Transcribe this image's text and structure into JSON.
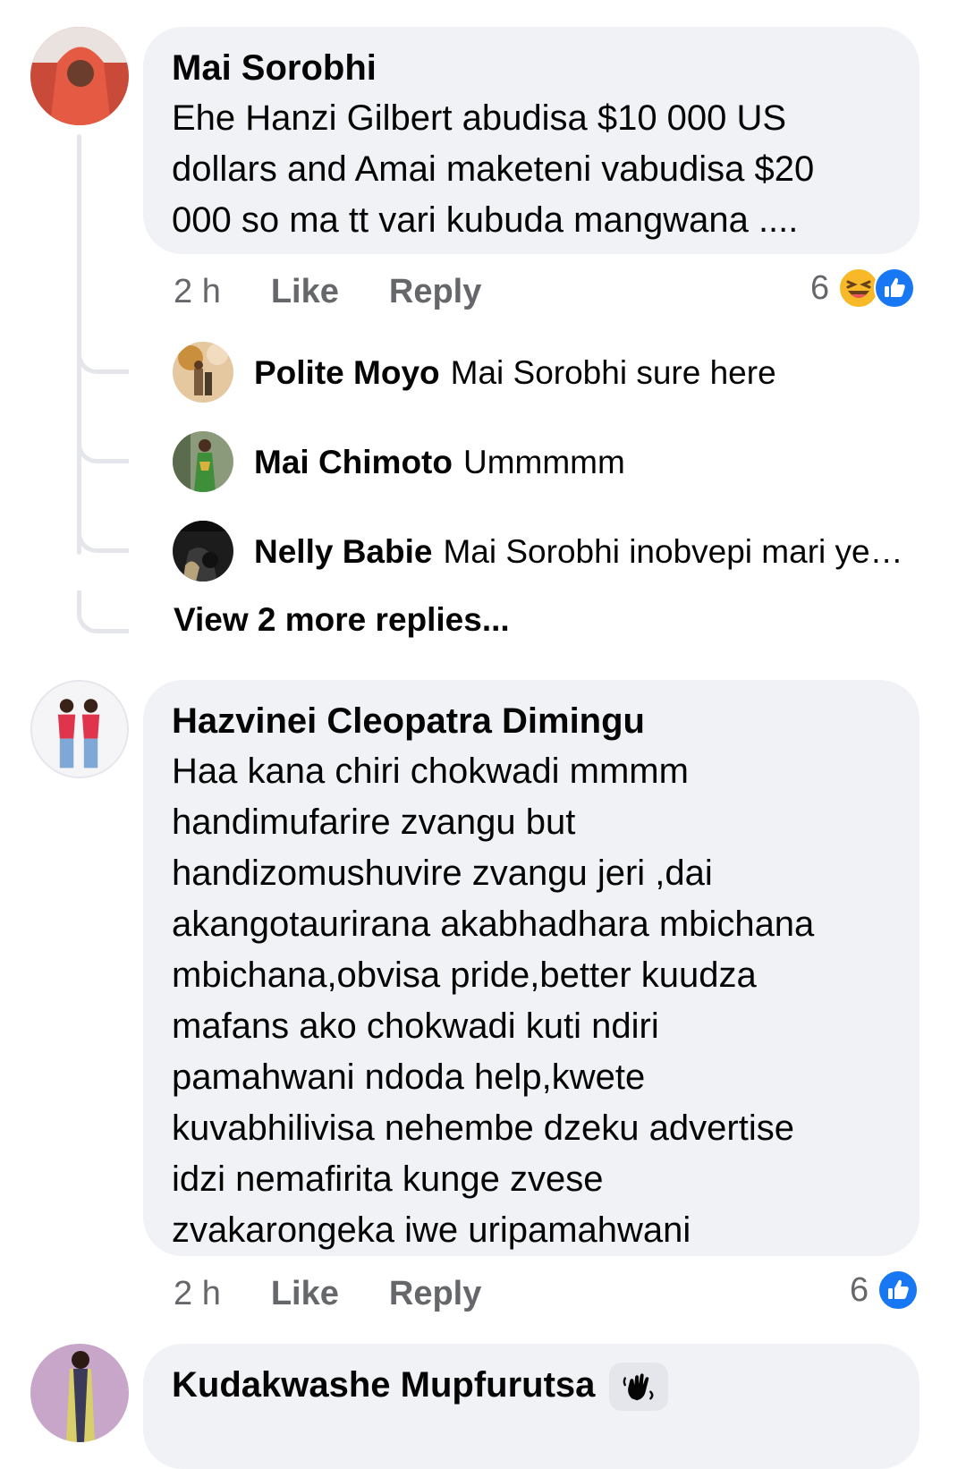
{
  "colors": {
    "bubble_bg": "#f0f2f5",
    "meta_text": "#65676b",
    "like_blue": "#1877f2",
    "haha_yellow": "#f7b928",
    "thread_line": "#e4e6eb"
  },
  "comments": [
    {
      "author": "Mai Sorobhi",
      "body_lines": [
        "Ehe Hanzi Gilbert abudisa $10 000 US",
        "dollars and Amai maketeni vabudisa $20",
        "000 so ma tt vari kubuda mangwana ...."
      ],
      "time": "2 h",
      "like_label": "Like",
      "reply_label": "Reply",
      "reaction_count": "6",
      "reaction_icons": [
        "haha-icon",
        "like-icon"
      ],
      "replies": [
        {
          "author": "Polite Moyo",
          "text": "Mai Sorobhi sure here"
        },
        {
          "author": "Mai Chimoto",
          "text": "Ummmmm"
        },
        {
          "author": "Nelly Babie",
          "text": "Mai Sorobhi inobvepi mari yese..."
        }
      ],
      "view_more": "View 2 more replies..."
    },
    {
      "author": "Hazvinei Cleopatra Dimingu",
      "body_lines": [
        "Haa kana chiri chokwadi mmmm",
        "handimufarire zvangu but",
        "handizomushuvire zvangu jeri ,dai",
        "akangotaurirana akabhadhara mbichana",
        "mbichana,obvisa pride,better kuudza",
        "mafans ako chokwadi kuti ndiri",
        "pamahwani ndoda help,kwete",
        "kuvabhilivisa nehembe dzeku advertise",
        "idzi nemafirita kunge zvese",
        "zvakarongeka iwe uripamahwani"
      ],
      "time": "2 h",
      "like_label": "Like",
      "reply_label": "Reply",
      "reaction_count": "6",
      "reaction_icons": [
        "like-icon"
      ]
    },
    {
      "author": "Kudakwashe Mupfurutsa",
      "badge_icon": "wave-hand-icon"
    }
  ]
}
